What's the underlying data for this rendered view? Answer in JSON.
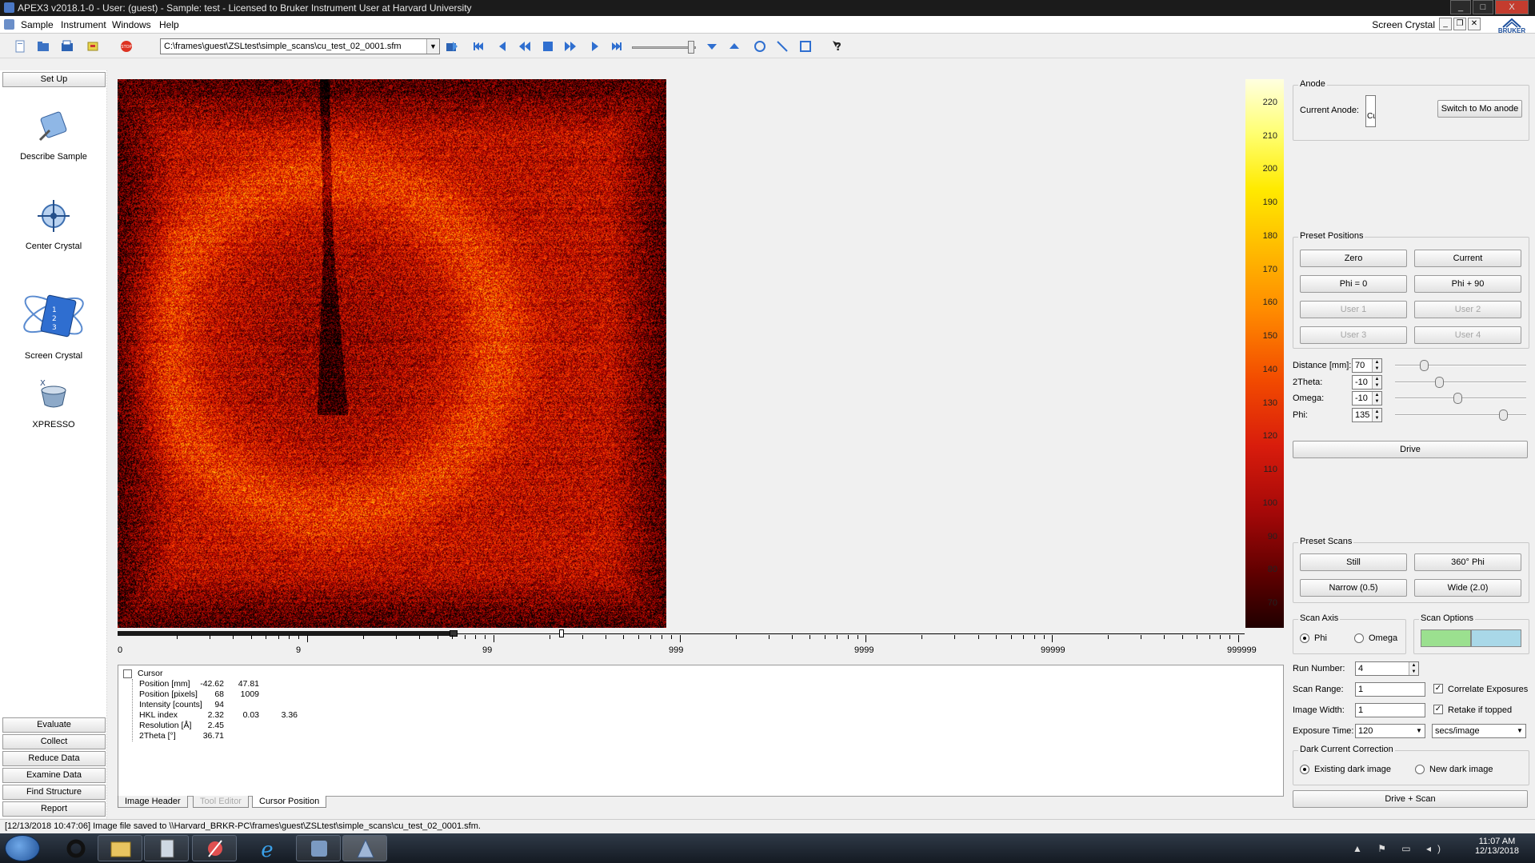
{
  "window": {
    "title": "APEX3 v2018.1-0 - User: (guest) - Sample: test - Licensed to Bruker Instrument User at Harvard University",
    "min": "_",
    "max": "□",
    "close": "X"
  },
  "menu": {
    "items": [
      "Sample",
      "Instrument",
      "Windows",
      "Help"
    ],
    "mode_label": "Screen Crystal",
    "brand": "BRUKER"
  },
  "toolbar": {
    "frame_path": "C:\\frames\\guest\\ZSLtest\\simple_scans\\cu_test_02_0001.sfm",
    "icons": [
      "new-icon",
      "open-icon",
      "open-folder-icon",
      "settings-icon",
      "stop-icon",
      "load-icon",
      "first-frame-icon",
      "prev-frame-icon",
      "rewind-icon",
      "stop-square-icon",
      "fast-forward-icon",
      "next-frame-icon",
      "last-frame-icon",
      "down-arrow-icon",
      "up-arrow-icon",
      "circle-tool-icon",
      "line-tool-icon",
      "rect-tool-icon",
      "help-icon"
    ]
  },
  "left_panel": {
    "setup_label": "Set Up",
    "nav": [
      {
        "label": "Describe Sample",
        "icon": "describe-sample-icon"
      },
      {
        "label": "Center Crystal",
        "icon": "center-crystal-icon"
      },
      {
        "label": "Screen Crystal",
        "icon": "screen-crystal-icon"
      },
      {
        "label": "XPRESSO",
        "icon": "xpresso-icon"
      }
    ],
    "bottom_buttons": [
      "Evaluate",
      "Collect",
      "Reduce Data",
      "Examine Data",
      "Find Structure",
      "Report"
    ]
  },
  "colorbar": {
    "labels": [
      "220",
      "210",
      "200",
      "190",
      "180",
      "170",
      "160",
      "150",
      "140",
      "130",
      "120",
      "110",
      "100",
      "90",
      "80",
      "70"
    ],
    "min": 70,
    "max": 220
  },
  "log_scale": {
    "labels": [
      "0",
      "9",
      "99",
      "999",
      "9999",
      "99999",
      "999999"
    ]
  },
  "cursor_info": {
    "header": "Cursor",
    "rows": [
      {
        "key": "Position [mm]",
        "v1": "-42.62",
        "v2": "47.81",
        "v3": ""
      },
      {
        "key": "Position [pixels]",
        "v1": "68",
        "v2": "1009",
        "v3": ""
      },
      {
        "key": "Intensity [counts]",
        "v1": "94",
        "v2": "",
        "v3": ""
      },
      {
        "key": "HKL index",
        "v1": "2.32",
        "v2": "0.03",
        "v3": "3.36"
      },
      {
        "key": "Resolution [Å]",
        "v1": "2.45",
        "v2": "",
        "v3": ""
      },
      {
        "key": "2Theta [°]",
        "v1": "36.71",
        "v2": "",
        "v3": ""
      }
    ]
  },
  "tabs": [
    "Image Header",
    "Tool Editor",
    "Cursor Position"
  ],
  "right_panel": {
    "anode": {
      "title": "Anode",
      "current_label": "Current Anode:",
      "current_value": "Cu",
      "switch_button": "Switch to Mo anode"
    },
    "preset_positions": {
      "title": "Preset Positions",
      "buttons": [
        "Zero",
        "Current",
        "Phi = 0",
        "Phi + 90",
        "User 1",
        "User 2",
        "User 3",
        "User 4"
      ]
    },
    "axes": [
      {
        "label": "Distance [mm]:",
        "value": "70",
        "level": 0.2
      },
      {
        "label": "2Theta:",
        "value": "-10",
        "level": 0.33
      },
      {
        "label": "Omega:",
        "value": "-10",
        "level": 0.48
      },
      {
        "label": "Phi:",
        "value": "135",
        "level": 0.85
      }
    ],
    "drive_button": "Drive",
    "preset_scans": {
      "title": "Preset Scans",
      "buttons": [
        "Still",
        "360° Phi",
        "Narrow (0.5)",
        "Wide (2.0)"
      ]
    },
    "scan_axis": {
      "title": "Scan Axis",
      "options": [
        "Phi",
        "Omega"
      ],
      "selected": "Phi"
    },
    "scan_options": {
      "title": "Scan Options",
      "color_a": "#9be08f",
      "color_b": "#a9d8e8"
    },
    "run_number_label": "Run Number:",
    "run_number": "4",
    "scan_range_label": "Scan Range:",
    "scan_range": "1",
    "image_width_label": "Image Width:",
    "image_width": "1",
    "correlate_label": "Correlate Exposures",
    "retake_label": "Retake if topped",
    "exposure_label": "Exposure Time:",
    "exposure_value": "120",
    "exposure_unit": "secs/image",
    "dark": {
      "title": "Dark Current Correction",
      "options": [
        "Existing dark image",
        "New dark image"
      ],
      "selected": "Existing dark image"
    },
    "drive_scan_button": "Drive + Scan"
  },
  "status": "[12/13/2018 10:47:06] Image file saved to \\\\Harvard_BRKR-PC\\frames\\guest\\ZSLtest\\simple_scans\\cu_test_02_0001.sfm.",
  "taskbar": {
    "time": "11:07 AM",
    "date": "12/13/2018"
  }
}
